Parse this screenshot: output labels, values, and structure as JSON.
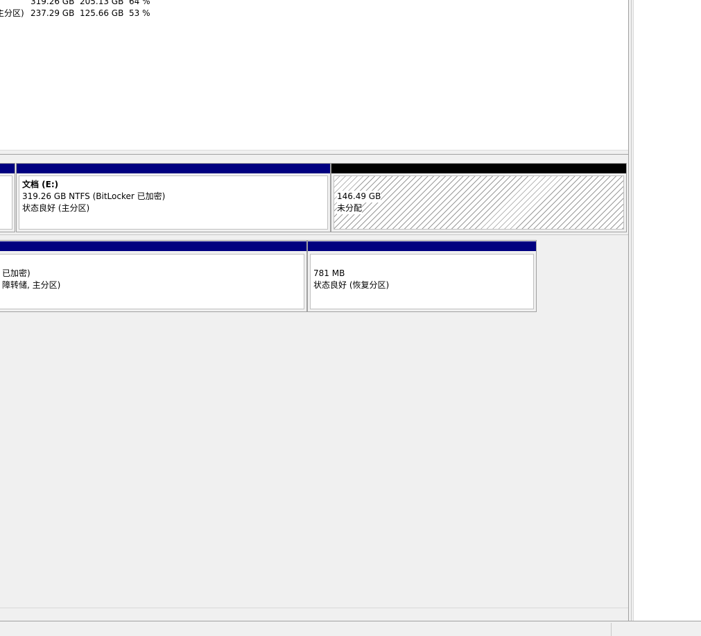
{
  "volume_list": {
    "rows": [
      {
        "label": "",
        "capacity": "319.26 GB",
        "free": "205.13 GB",
        "percent": "64 %"
      },
      {
        "label": "主分区)",
        "capacity": "237.29 GB",
        "free": "125.66 GB",
        "percent": "53 %"
      }
    ]
  },
  "disk0": {
    "partitions": [
      {
        "name": "文档 (E:)",
        "line1": "319.26 GB NTFS (BitLocker 已加密)",
        "line2": "状态良好 (主分区)"
      },
      {
        "name": "",
        "line1": "146.49 GB",
        "line2": "未分配"
      }
    ]
  },
  "disk1": {
    "partitions": [
      {
        "line1": "已加密)",
        "line2": "障转储, 主分区)"
      },
      {
        "line1": "781 MB",
        "line2": "状态良好 (恢复分区)"
      }
    ]
  }
}
